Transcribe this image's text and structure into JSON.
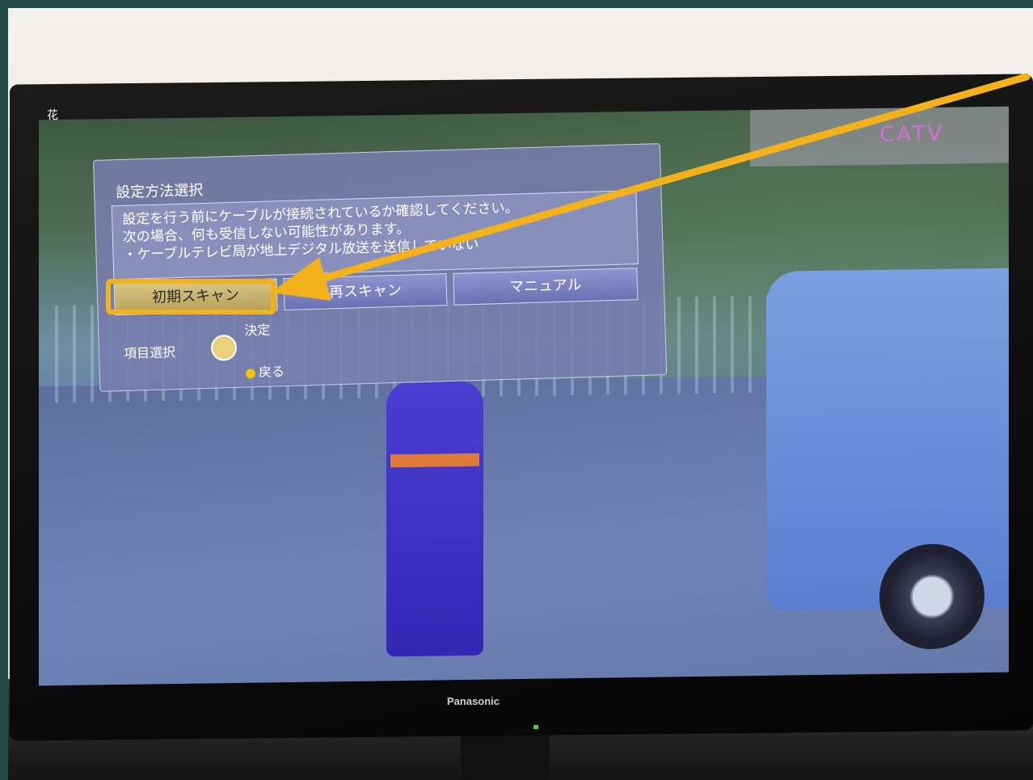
{
  "dialog": {
    "title": "設定方法選択",
    "message_line1": "設定を行う前にケーブルが接続されているか確認してください。",
    "message_line2": "次の場合、何も受信しない可能性があります。",
    "message_line3": "・ケーブルテレビ局が地上デジタル放送を送信していない",
    "buttons": [
      "初期スキャン",
      "再スキャン",
      "マニュアル"
    ],
    "selected_button": "初期スキャン",
    "legend_confirm": "決定",
    "legend_select": "項目選択",
    "legend_back": "戻る"
  },
  "screen": {
    "channel_label": "CATV",
    "left_text": "花"
  },
  "tv": {
    "brand": "Panasonic"
  },
  "annotation": {
    "highlight_color": "#f3b21b",
    "arrow_color": "#f3b21b"
  },
  "colors": {
    "dialog_bg": "#787daf",
    "selected_button": "#d9c785",
    "frame": "#234a48"
  }
}
